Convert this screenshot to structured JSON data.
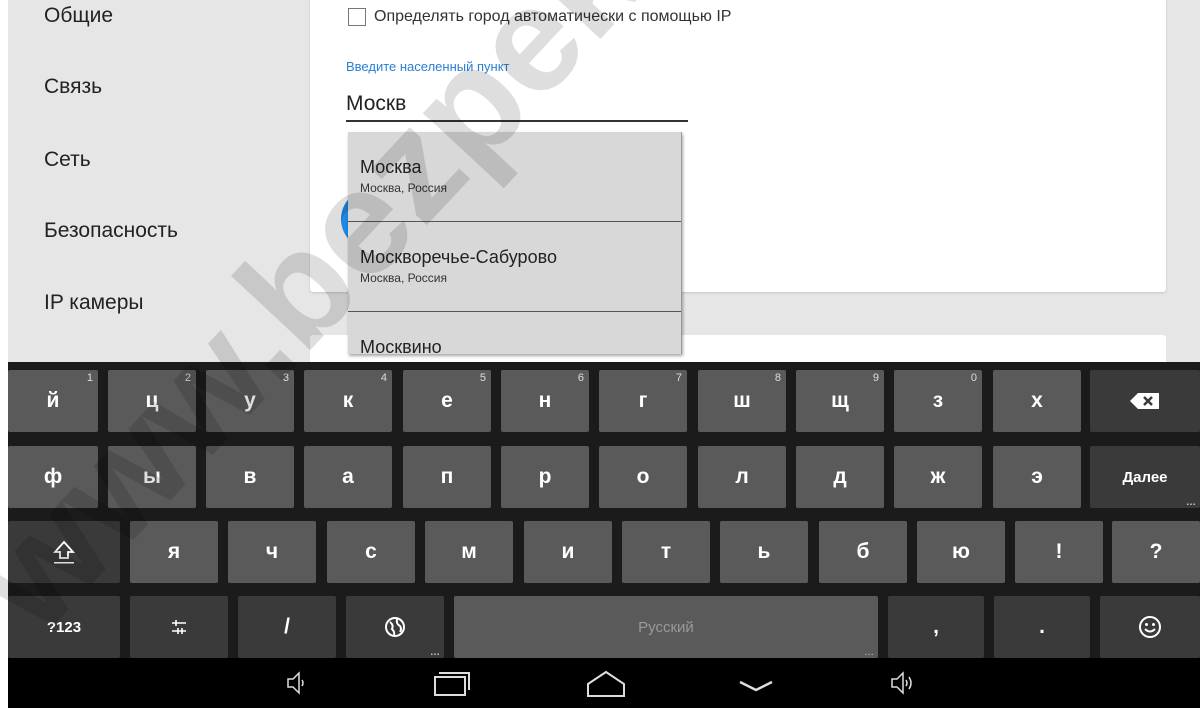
{
  "sidebar": {
    "items": [
      {
        "label": "Общие"
      },
      {
        "label": "Связь"
      },
      {
        "label": "Сеть"
      },
      {
        "label": "Безопасность"
      },
      {
        "label": "IP камеры"
      }
    ]
  },
  "location": {
    "auto_checkbox_label": "Определять город автоматически с помощью IP",
    "auto_checked": false,
    "field_label": "Введите населенный пункт",
    "field_value": "Москв"
  },
  "suggestions": [
    {
      "title": "Москва",
      "subtitle": "Москва, Россия"
    },
    {
      "title": "Москворечье-Сабурово",
      "subtitle": "Москва, Россия"
    },
    {
      "title": "Москвино",
      "subtitle": ""
    }
  ],
  "keyboard": {
    "row1": [
      {
        "label": "й",
        "hint": "1"
      },
      {
        "label": "ц",
        "hint": "2"
      },
      {
        "label": "у",
        "hint": "3"
      },
      {
        "label": "к",
        "hint": "4"
      },
      {
        "label": "е",
        "hint": "5"
      },
      {
        "label": "н",
        "hint": "6"
      },
      {
        "label": "г",
        "hint": "7"
      },
      {
        "label": "ш",
        "hint": "8"
      },
      {
        "label": "щ",
        "hint": "9"
      },
      {
        "label": "з",
        "hint": "0"
      },
      {
        "label": "х",
        "hint": ""
      }
    ],
    "row2": [
      {
        "label": "ф"
      },
      {
        "label": "ы"
      },
      {
        "label": "в"
      },
      {
        "label": "а"
      },
      {
        "label": "п"
      },
      {
        "label": "р"
      },
      {
        "label": "о"
      },
      {
        "label": "л"
      },
      {
        "label": "д"
      },
      {
        "label": "ж"
      },
      {
        "label": "э"
      }
    ],
    "row3": [
      {
        "label": "я"
      },
      {
        "label": "ч"
      },
      {
        "label": "с"
      },
      {
        "label": "м"
      },
      {
        "label": "и"
      },
      {
        "label": "т"
      },
      {
        "label": "ь"
      },
      {
        "label": "б"
      },
      {
        "label": "ю"
      },
      {
        "label": "!"
      },
      {
        "label": "?"
      }
    ],
    "next_label": "Далее",
    "symbols_label": "?123",
    "slash_label": "/",
    "space_label": "Русский",
    "comma_label": ",",
    "period_label": ".",
    "backspace_icon": "backspace-icon",
    "shift_icon": "shift-icon",
    "settings_icon": "settings-sliders-icon",
    "globe_icon": "globe-icon",
    "emoji_icon": "emoji-icon"
  },
  "navbar": {
    "icons": [
      "volume-down-icon",
      "recent-apps-icon",
      "home-icon",
      "hide-keyboard-icon",
      "volume-up-icon"
    ]
  },
  "watermark": {
    "text": "www.bezpeka"
  },
  "colors": {
    "accent": "#1e88e5",
    "label_blue": "#2a7fd4",
    "keyboard_bg": "#1b1b1b",
    "key_bg": "#5a5a5a"
  }
}
